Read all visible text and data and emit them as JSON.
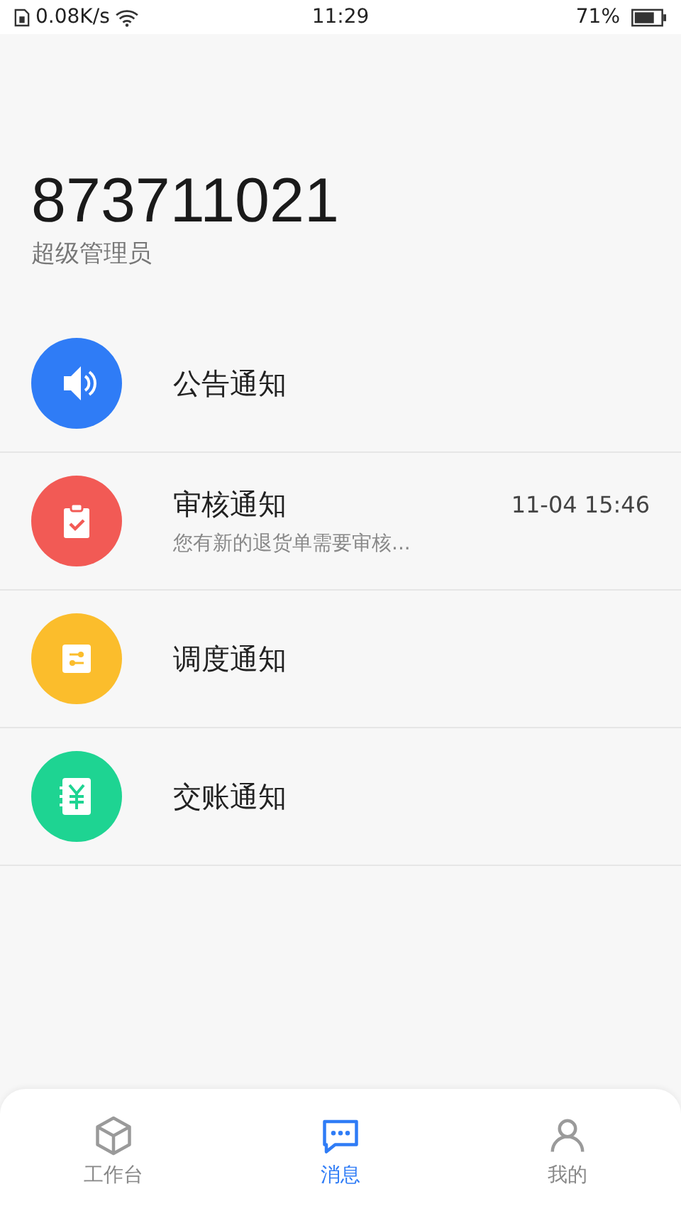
{
  "status_bar": {
    "speed": "0.08K/s",
    "time": "11:29",
    "battery": "71%"
  },
  "account": {
    "number": "873711021",
    "role": "超级管理员"
  },
  "notifications": [
    {
      "title": "公告通知",
      "color": "#2f7cf6"
    },
    {
      "title": "审核通知",
      "color": "#f25a55",
      "time": "11-04 15:46",
      "preview": "您有新的退货单需要审核..."
    },
    {
      "title": "调度通知",
      "color": "#fbbd2c"
    },
    {
      "title": "交账通知",
      "color": "#1ed492"
    }
  ],
  "tabs": [
    {
      "label": "工作台",
      "selected": false
    },
    {
      "label": "消息",
      "selected": true
    },
    {
      "label": "我的",
      "selected": false
    }
  ]
}
